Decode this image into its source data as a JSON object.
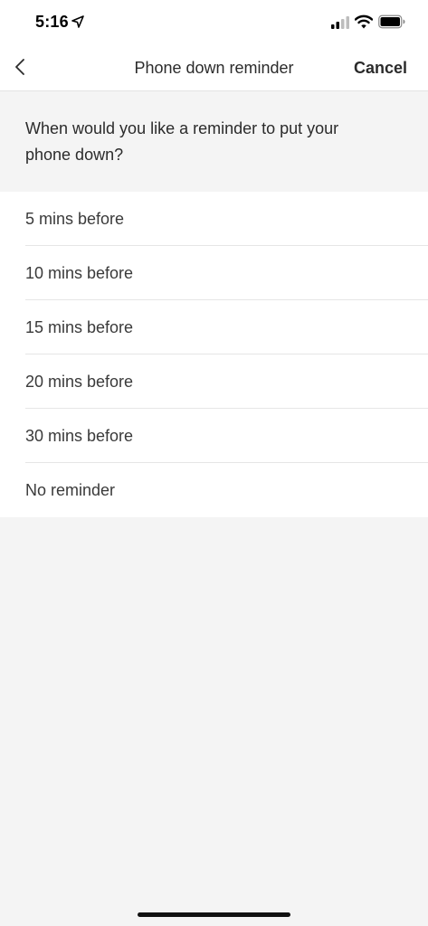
{
  "status_bar": {
    "time": "5:16",
    "icons": [
      "location-arrow-icon",
      "cellular-signal-icon",
      "wifi-icon",
      "battery-icon"
    ]
  },
  "nav": {
    "back_icon": "chevron-left-icon",
    "title": "Phone down reminder",
    "cancel_label": "Cancel"
  },
  "prompt": {
    "text": "When would you like a reminder to put your phone down?"
  },
  "options": [
    {
      "label": "5 mins before"
    },
    {
      "label": "10 mins before"
    },
    {
      "label": "15 mins before"
    },
    {
      "label": "20 mins before"
    },
    {
      "label": "30 mins before"
    },
    {
      "label": "No reminder"
    }
  ],
  "colors": {
    "background": "#f4f4f4",
    "surface": "#ffffff",
    "text": "#2b2b2b",
    "divider": "#e6e6e6"
  }
}
